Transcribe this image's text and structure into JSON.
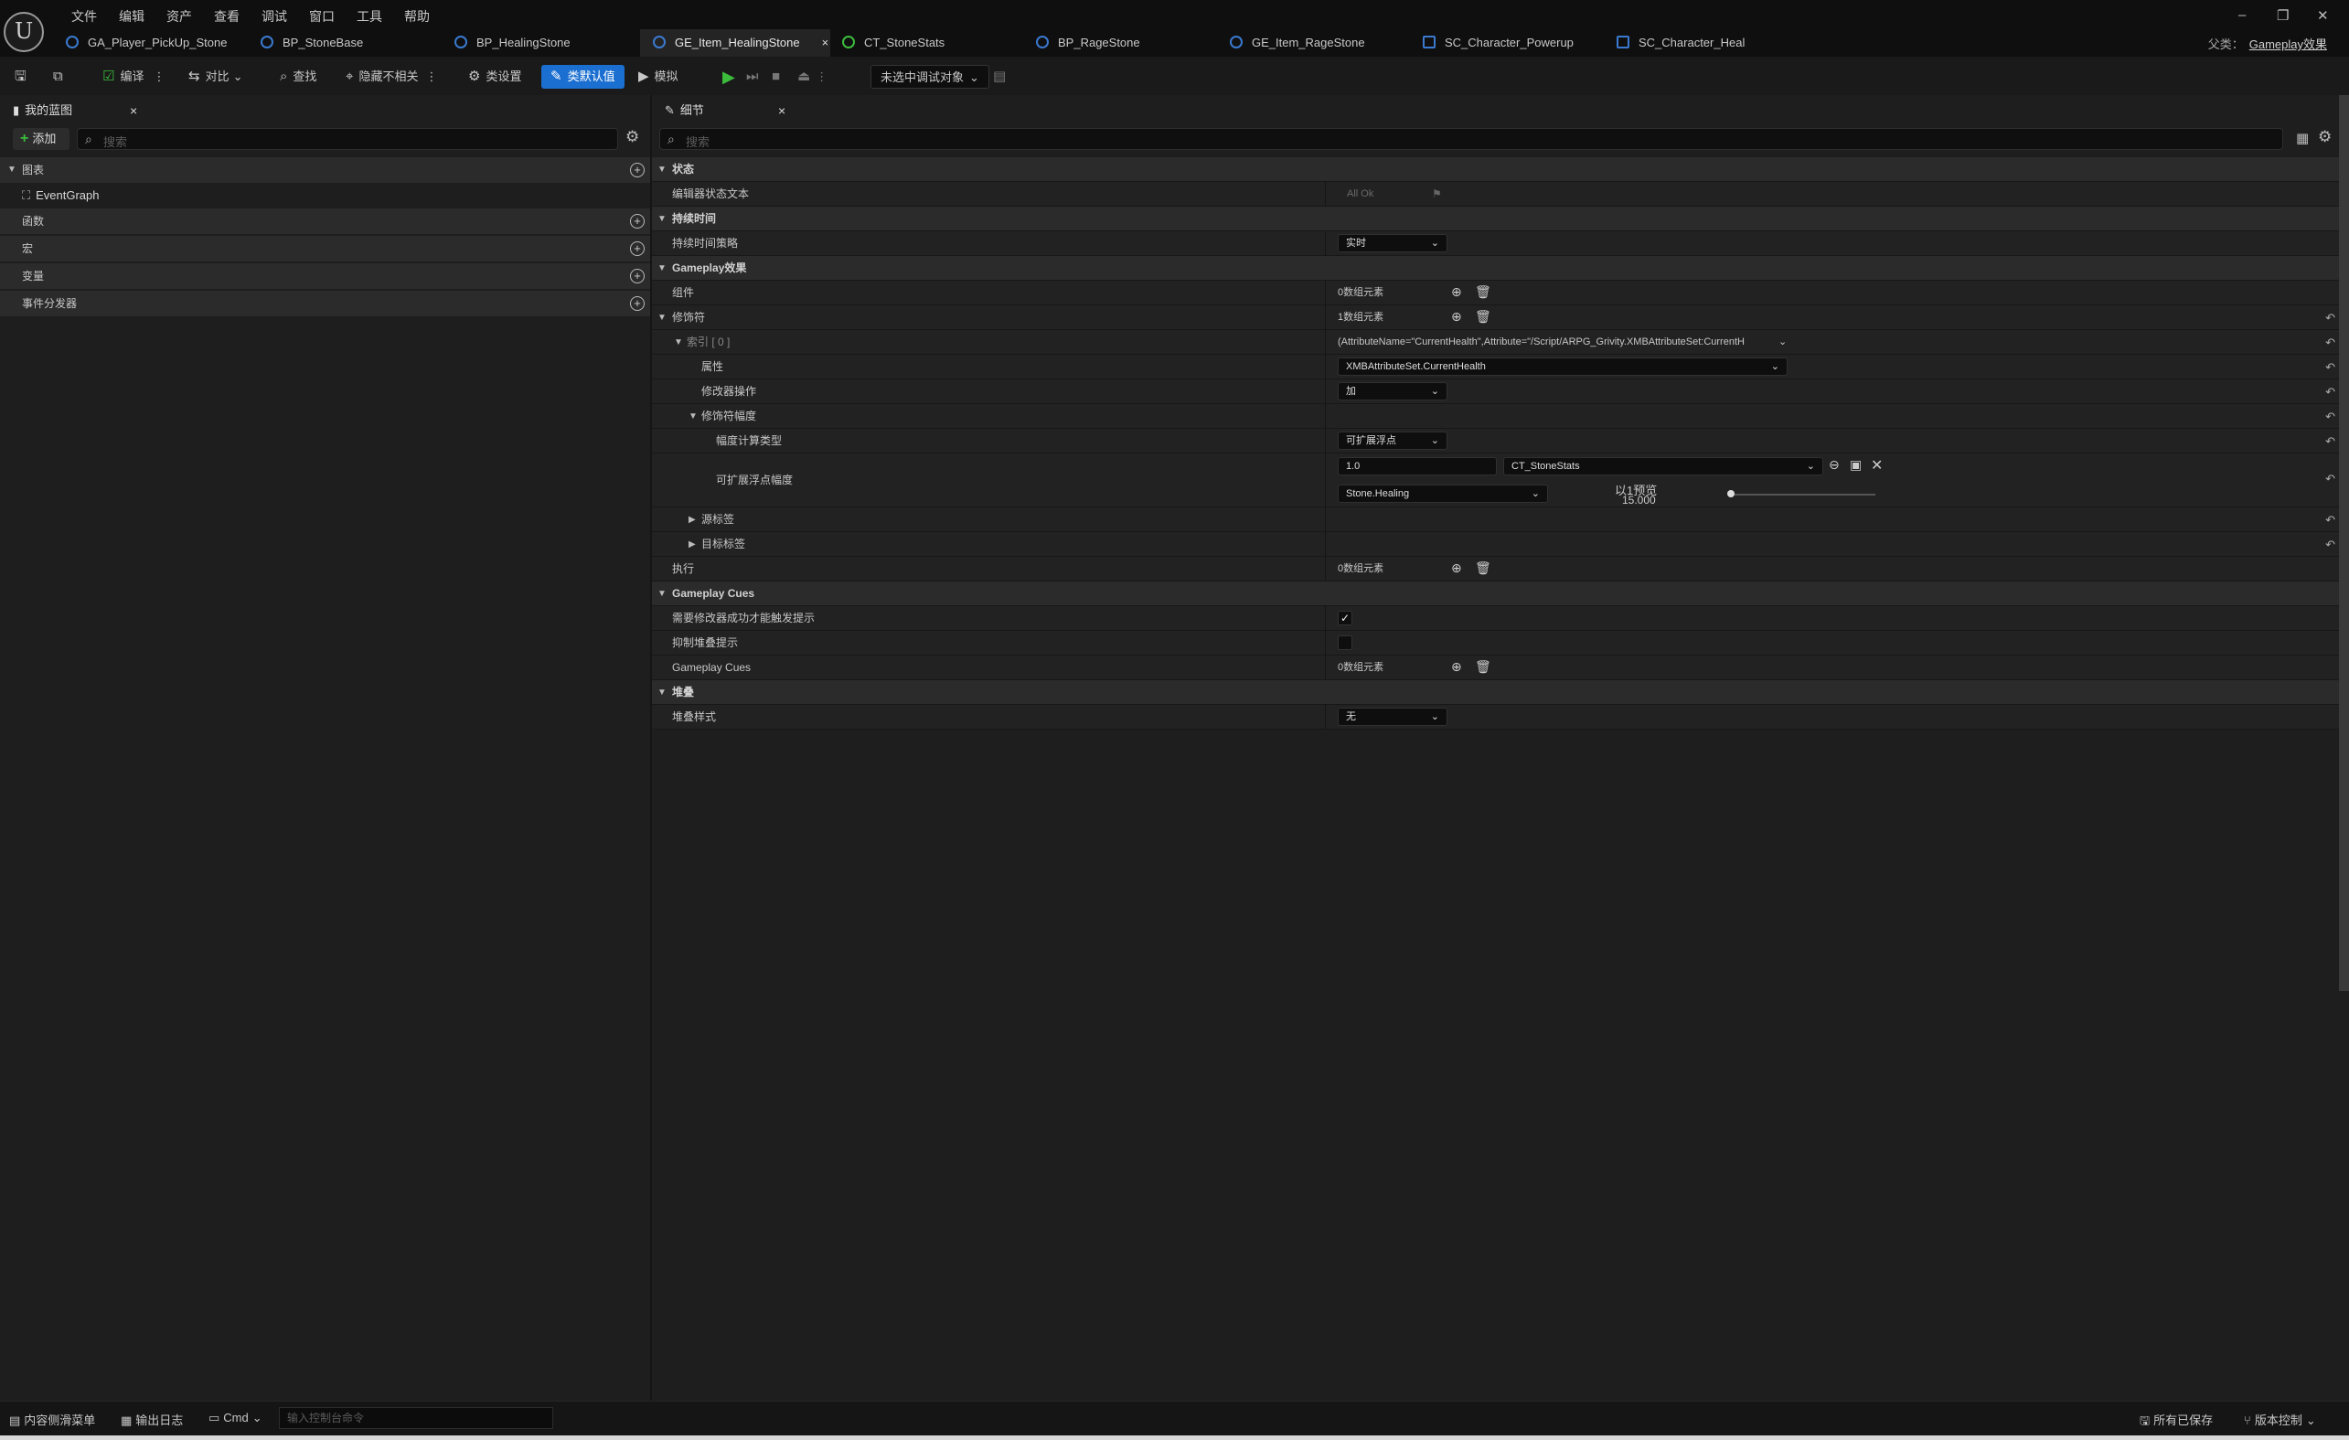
{
  "menu": [
    "文件",
    "编辑",
    "资产",
    "查看",
    "调试",
    "窗口",
    "工具",
    "帮助"
  ],
  "tabs": [
    {
      "label": "GA_Player_PickUp_Stone"
    },
    {
      "label": "BP_StoneBase"
    },
    {
      "label": "BP_HealingStone"
    },
    {
      "label": "GE_Item_HealingStone",
      "active": true
    },
    {
      "label": "CT_StoneStats"
    },
    {
      "label": "BP_RageStone"
    },
    {
      "label": "GE_Item_RageStone"
    },
    {
      "label": "SC_Character_Powerup"
    },
    {
      "label": "SC_Character_Heal"
    }
  ],
  "parent": {
    "label": "父类：",
    "value": "Gameplay效果"
  },
  "toolbar": {
    "compile": "编译",
    "diff": "对比",
    "find": "查找",
    "hide_unrelated": "隐藏不相关",
    "class_settings": "类设置",
    "class_defaults": "类默认值",
    "simulate": "模拟",
    "debug_target": "未选中调试对象"
  },
  "left_panel": {
    "tab": "我的蓝图",
    "add": "添加",
    "search_placeholder": "搜索",
    "sections": {
      "graphs": "图表",
      "functions": "函数",
      "macros": "宏",
      "variables": "变量",
      "dispatchers": "事件分发器"
    },
    "event_graph": "EventGraph"
  },
  "details": {
    "tab": "细节",
    "search_placeholder": "搜索",
    "cat_status": "状态",
    "editor_status_text": "编辑器状态文本",
    "status_value": "All Ok",
    "cat_duration": "持续时间",
    "duration_policy": "持续时间策略",
    "duration_value": "实时",
    "cat_gameplay_effect": "Gameplay效果",
    "components": "组件",
    "components_value": "0数组元素",
    "modifiers": "修饰符",
    "modifiers_value": "1数组元素",
    "index0": "索引 [ 0 ]",
    "index0_value": "(AttributeName=\"CurrentHealth\",Attribute=\"/Script/ARPG_Grivity.XMBAttributeSet:CurrentH",
    "attribute": "属性",
    "attribute_value": "XMBAttributeSet.CurrentHealth",
    "modifier_op": "修改器操作",
    "modifier_op_value": "加",
    "modifier_magnitude": "修饰符幅度",
    "magnitude_calc_type": "幅度计算类型",
    "magnitude_calc_value": "可扩展浮点",
    "scalable_float": "可扩展浮点幅度",
    "sf_value": "1.0",
    "sf_table": "CT_StoneStats",
    "sf_row": "Stone.Healing",
    "preview_label": "以1预览",
    "preview_value": "15.000",
    "source_tags": "源标签",
    "target_tags": "目标标签",
    "executions": "执行",
    "executions_value": "0数组元素",
    "cat_cues": "Gameplay Cues",
    "require_success": "需要修改器成功才能触发提示",
    "suppress_stacking": "抑制堆叠提示",
    "gameplay_cues": "Gameplay Cues",
    "gameplay_cues_value": "0数组元素",
    "cat_stacking": "堆叠",
    "stacking_type": "堆叠样式",
    "stacking_value": "无"
  },
  "status": {
    "content_drawer": "内容侧滑菜单",
    "output_log": "输出日志",
    "cmd": "Cmd",
    "cmd_placeholder": "输入控制台命令",
    "all_saved": "所有已保存",
    "source_control": "版本控制"
  }
}
